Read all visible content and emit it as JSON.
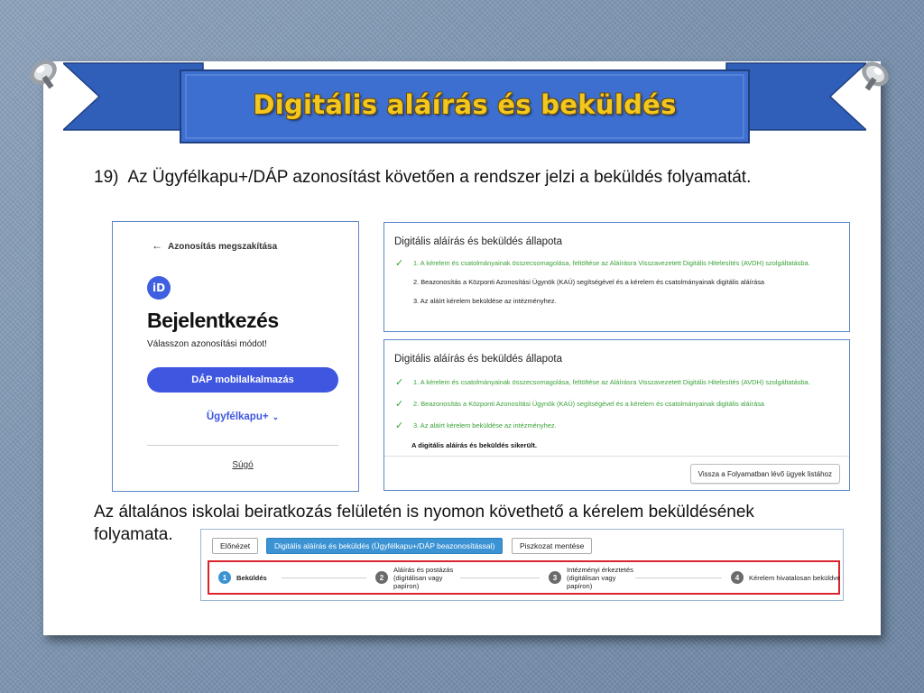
{
  "slide": {
    "title": "Digitális aláírás és beküldés",
    "step_number": "19)",
    "step_text": "Az Ügyfélkapu+/DÁP azonosítást követően a rendszer jelzi a beküldés folyamatát.",
    "paragraph": "Az általános iskolai beiratkozás felületén is nyomon követhető a kérelem beküldésének folyamata."
  },
  "login": {
    "back_label": "Azonosítás megszakítása",
    "logo_text": "iD",
    "title": "Bejelentkezés",
    "subtitle": "Válasszon azonosítási módot!",
    "dap_button": "DÁP mobilalkalmazás",
    "ugyfelkapu_label": "Ügyfélkapu+",
    "help_link": "Súgó"
  },
  "status_panel_1": {
    "title": "Digitális aláírás és beküldés állapota",
    "items": [
      {
        "text": "1. A kérelem és csatolmányainak összecsomagolása, feltöltése az Aláírásra Visszavezetett Digitális Hitelesítés (AVDH) szolgáltatásba.",
        "state": "done"
      },
      {
        "text": "2. Beazonosítás a Központi Azonosítási Ügynök (KAÜ) segítségével és a kérelem és csatolmányainak digitális aláírása",
        "state": "pending"
      },
      {
        "text": "3. Az aláírt kérelem beküldése az intézményhez.",
        "state": "pending"
      }
    ]
  },
  "status_panel_2": {
    "title": "Digitális aláírás és beküldés állapota",
    "items": [
      {
        "text": "1. A kérelem és csatolmányainak összecsomagolása, feltöltése az Aláírásra Visszavezetett Digitális Hitelesítés (AVDH) szolgáltatásba.",
        "state": "done"
      },
      {
        "text": "2. Beazonosítás a Központi Azonosítási Ügynök (KAÜ) segítségével és a kérelem és csatolmányainak digitális aláírása",
        "state": "done"
      },
      {
        "text": "3. Az aláírt kérelem beküldése az intézményhez.",
        "state": "done"
      }
    ],
    "success_message": "A digitális aláírás és beküldés sikerült.",
    "back_button": "Vissza a Folyamatban lévő ügyek listához"
  },
  "app": {
    "toolbar": {
      "preview": "Előnézet",
      "sign": "Digitális aláírás és beküldés (Ügyfélkapu+/DÁP beazonosítással)",
      "draft": "Piszkozat mentése"
    },
    "wizard": [
      {
        "number": "1",
        "lines": [
          "Beküldés"
        ],
        "active": true
      },
      {
        "number": "2",
        "lines": [
          "Aláírás és postázás",
          "(digitálisan vagy",
          "papíron)"
        ],
        "active": false
      },
      {
        "number": "3",
        "lines": [
          "Intézményi érkeztetés",
          "(digitálisan vagy",
          "papíron)"
        ],
        "active": false
      },
      {
        "number": "4",
        "lines": [
          "Kérelem hivatalosan beküldve"
        ],
        "active": false
      }
    ]
  },
  "colors": {
    "accent_blue": "#3f56e0",
    "success_green": "#3aa23a",
    "step_active": "#3b93d4",
    "highlight_red": "#d9242c",
    "title_gold": "#f2c81e",
    "ribbon_blue": "#3d6fd0"
  },
  "icons": {
    "back": "arrow-left-icon",
    "check": "check-icon",
    "dropdown": "chevron-down-icon",
    "pin": "pushpin-icon"
  }
}
